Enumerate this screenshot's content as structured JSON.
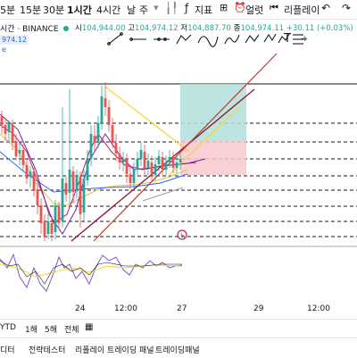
{
  "toolbar": {
    "timeframes": [
      "5분",
      "15분",
      "30분",
      "1시간",
      "4시간",
      "날",
      "주"
    ],
    "active_timeframe": "1시간",
    "indicators_label": "지표",
    "alert_label": "얼럿",
    "replay_label": "리플레이"
  },
  "legend": {
    "title": "시간 · BINANCE",
    "price_tag": "974.12",
    "open_label": "시",
    "open_value": "104,944.00",
    "high_label": "고",
    "high_value": "104,974.12",
    "low_label": "저",
    "low_value": "104,887.70",
    "close_label": "종",
    "close_value": "104,974.11",
    "change": "+30.11 (+0.03%)",
    "sub_label": "e"
  },
  "drawing_tools": [
    "trend-line",
    "horizontal-ray",
    "extended-line",
    "path",
    "curve",
    "brush",
    "polyline",
    "xabcd-pattern",
    "elliott-wave",
    "fib-channel",
    "text",
    "pin"
  ],
  "time_axis": [
    "24",
    "12:00",
    "27",
    "29",
    "12:00"
  ],
  "bottom_bar": {
    "range": "YTD",
    "d1": "1해",
    "d5": "5해",
    "adjust": "전체"
  },
  "bottom_tabs": [
    "디터",
    "전략테스터",
    "리플레이 트레이딩 패널",
    "트레이딩패널"
  ],
  "colors": {
    "up": "#26a69a",
    "down": "#ef5350",
    "accent": "#2962ff",
    "yellow_line": "#f5d72e",
    "maroon_line": "#8e1d3b",
    "target_zone": "#b2dfdb",
    "stop_zone": "#f8c8cc",
    "rsi": "#7e57c2"
  }
}
